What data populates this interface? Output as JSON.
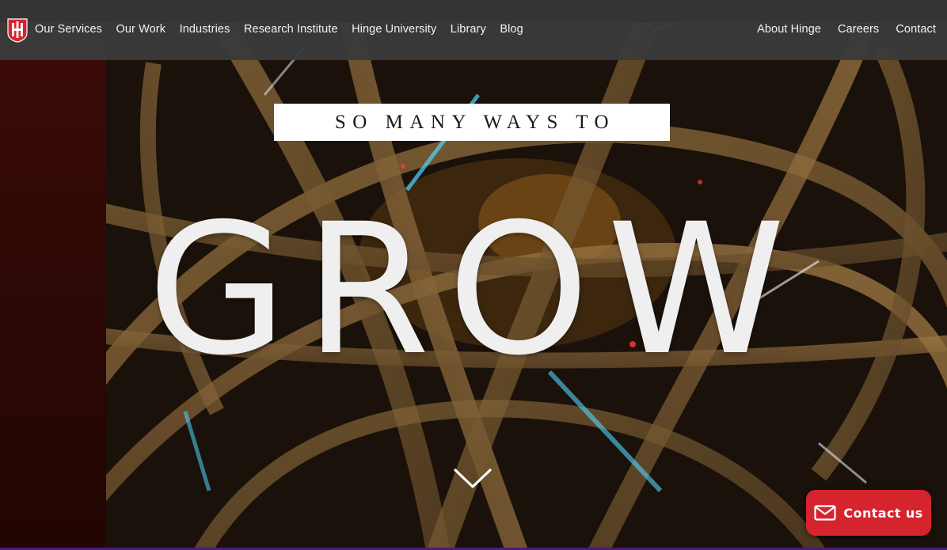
{
  "nav": {
    "logo_icon": "hinge-logo-icon",
    "left_items": [
      {
        "label": "Our Services"
      },
      {
        "label": "Our Work"
      },
      {
        "label": "Industries"
      },
      {
        "label": "Research Institute"
      },
      {
        "label": "Hinge University"
      },
      {
        "label": "Library"
      },
      {
        "label": "Blog"
      }
    ],
    "right_items": [
      {
        "label": "About Hinge"
      },
      {
        "label": "Careers"
      },
      {
        "label": "Contact"
      }
    ]
  },
  "hero": {
    "tagline": "SO MANY WAYS TO",
    "headline": "GROW",
    "scroll_icon": "chevron-down-icon",
    "background": "aerial-highway-interchange-at-night"
  },
  "contact_widget": {
    "label": "Contact us",
    "icon": "mail-icon"
  },
  "colors": {
    "brand_red": "#d6242e",
    "nav_bg": "#3a3a3a",
    "headline_text": "#efefef",
    "tagline_bg": "#ffffff",
    "tagline_text": "#1a1a1a",
    "bottom_accent": "#4b1a7a"
  }
}
